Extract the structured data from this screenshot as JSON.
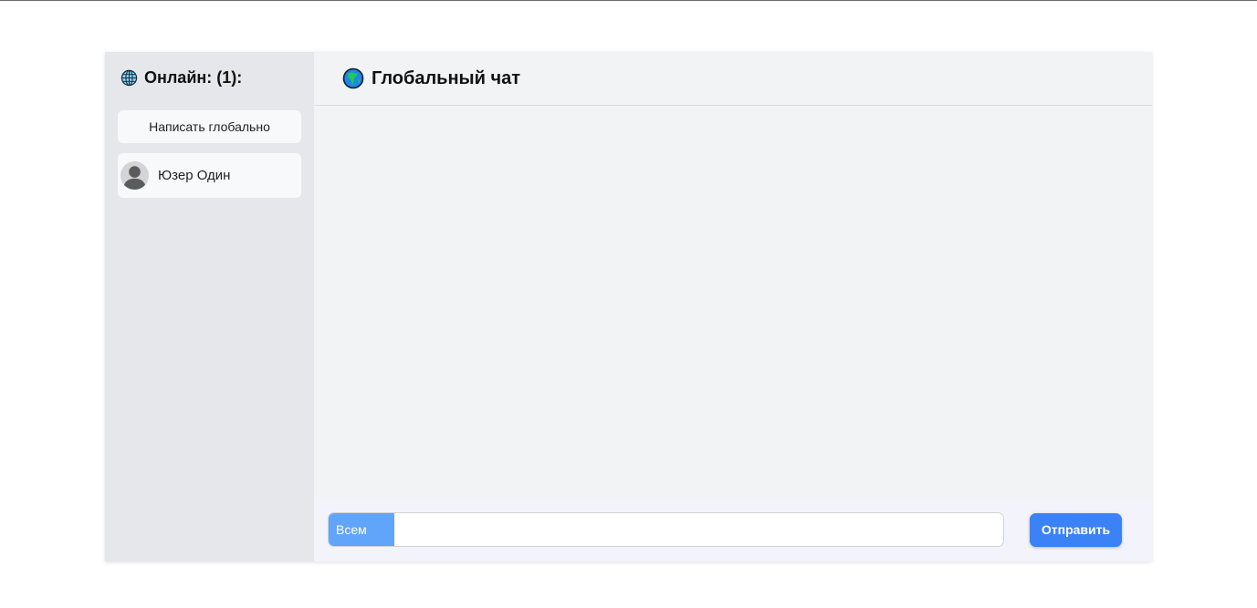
{
  "sidebar": {
    "online_label": "Онлайн: (1):",
    "online_icon": "globe-meridians-icon",
    "write_global_label": "Написать глобально",
    "users": [
      {
        "name": "Юзер Один",
        "avatar_icon": "user-silhouette-icon"
      }
    ]
  },
  "chat": {
    "title": "Глобальный чат",
    "title_icon": "earth-globe-icon",
    "messages": []
  },
  "composer": {
    "recipient_label": "Всем",
    "input_value": "",
    "input_placeholder": "",
    "send_label": "Отправить"
  },
  "colors": {
    "accent": "#3b82f6",
    "recipient_bg": "#60a5fa",
    "sidebar_bg": "#e5e7eb",
    "main_bg": "#f2f3f5"
  }
}
